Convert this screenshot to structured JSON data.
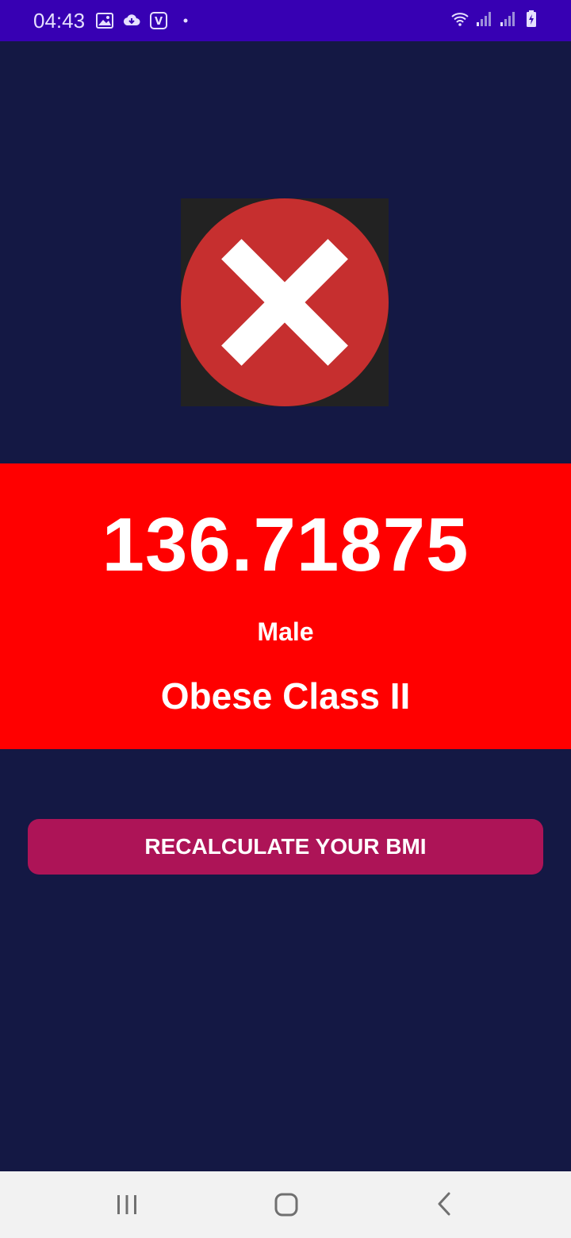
{
  "status_bar": {
    "time": "04:43",
    "left_icons": [
      "gallery-icon",
      "cloud-download-icon",
      "voicemail-icon",
      "dot-icon"
    ],
    "right_icons": [
      "wifi-icon",
      "signal-icon",
      "signal-icon",
      "battery-charging-icon"
    ]
  },
  "result": {
    "image_icon": "error-x-circle-icon",
    "bmi_value": "136.71875",
    "gender": "Male",
    "category": "Obese Class II",
    "panel_color": "#ff0000"
  },
  "actions": {
    "recalculate_label": "RECALCULATE YOUR BMI",
    "button_color": "#ad1457"
  },
  "nav_bar": {
    "buttons": [
      "recent-apps-icon",
      "home-icon",
      "back-icon"
    ]
  },
  "colors": {
    "background": "#141844",
    "status_bar": "#3700b3"
  }
}
